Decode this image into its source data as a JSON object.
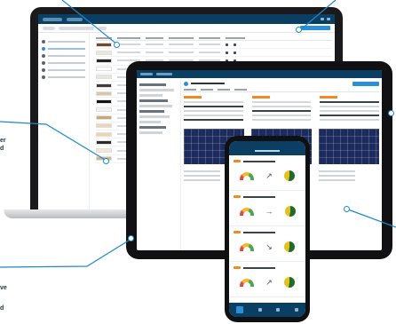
{
  "callouts": [
    {
      "text": "er"
    },
    {
      "text": "d"
    },
    {
      "text": "ve"
    },
    {
      "text": "d"
    }
  ],
  "colors": {
    "callout_line": "#1e88c8",
    "app_header": "#0b3e63",
    "accent_blue": "#2a8fd6",
    "accent_orange": "#f08a24"
  },
  "devices": [
    "laptop",
    "tablet",
    "phone"
  ],
  "laptop_swatches": [
    "#6b4a2f",
    "#efe6d8",
    "#242424",
    "#ffffff",
    "#e8e4de",
    "#3b3b3b",
    "#d9c7a8",
    "#121212",
    "#f2f2f2",
    "#c8a77b",
    "#e9d6b8",
    "#f0d5a8",
    "#2a2a2a",
    "#f5e6cf",
    "#d6b58a"
  ],
  "phone_cards": [
    {
      "gauge": "gauge-icon",
      "trend": "arrow-up-icon",
      "pie": "pie-chart-icon"
    },
    {
      "gauge": "gauge-icon",
      "trend": "arrow-right-icon",
      "pie": "pie-chart-icon"
    },
    {
      "gauge": "gauge-icon",
      "trend": "arrow-down-icon",
      "pie": "pie-chart-icon"
    },
    {
      "gauge": "gauge-icon",
      "trend": "arrow-up-icon",
      "pie": "pie-chart-icon"
    }
  ]
}
